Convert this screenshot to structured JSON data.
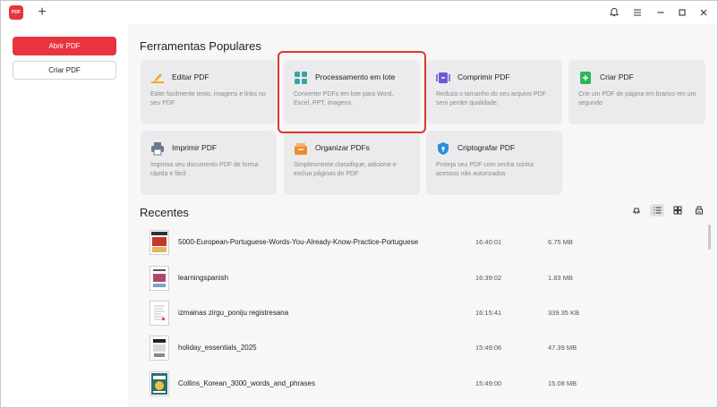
{
  "titlebar": {
    "logo_text": "PDF",
    "new_tab": "+",
    "controls": [
      "🔔",
      "≡",
      "—",
      "☐",
      "✕"
    ]
  },
  "sidebar": {
    "open_label": "Abrir PDF",
    "create_label": "Criar PDF"
  },
  "popular": {
    "title": "Ferramentas Populares",
    "tools": [
      {
        "title": "Editar PDF",
        "desc": "Edite facilmente texto, imagens e links no seu PDF",
        "icon": "edit-icon"
      },
      {
        "title": "Processamento em lote",
        "desc": "Converter PDFs em lote para Word, Excel, PPT, imagens.",
        "icon": "batch-icon"
      },
      {
        "title": "Comprimir PDF",
        "desc": "Reduza o tamanho do seu arquivo PDF sem perder qualidade.",
        "icon": "compress-icon"
      },
      {
        "title": "Criar PDF",
        "desc": "Crie um PDF de página em branco em um segundo",
        "icon": "create-icon"
      },
      {
        "title": "Imprimir PDF",
        "desc": "Imprima seu documento PDF de forma rápida e fácil",
        "icon": "print-icon"
      },
      {
        "title": "Organizar PDFs",
        "desc": "Simplesmente classifique, adicione e exclua páginas de PDF",
        "icon": "organize-icon"
      },
      {
        "title": "Criptografar PDF",
        "desc": "Proteja seu PDF com senha contra acessos não autorizados",
        "icon": "encrypt-icon"
      }
    ]
  },
  "recent": {
    "title": "Recentes",
    "files": [
      {
        "name": "5000-European-Portuguese-Words-You-Already-Know-Practice-Portuguese",
        "time": "16:40:01",
        "size": "6.75 MB"
      },
      {
        "name": "learningspanish",
        "time": "16:39:02",
        "size": "1.83 MB"
      },
      {
        "name": "izmainas zirgu_poniju registresana",
        "time": "16:15:41",
        "size": "339.35 KB"
      },
      {
        "name": "holiday_essentials_2025",
        "time": "15:49:06",
        "size": "47.39 MB"
      },
      {
        "name": "Collins_Korean_3000_words_and_phrases",
        "time": "15:49:00",
        "size": "15.08 MB"
      }
    ]
  },
  "colors": {
    "accent": "#e8343e",
    "highlight_border": "#d93a2a",
    "card_bg": "#ebebed"
  }
}
